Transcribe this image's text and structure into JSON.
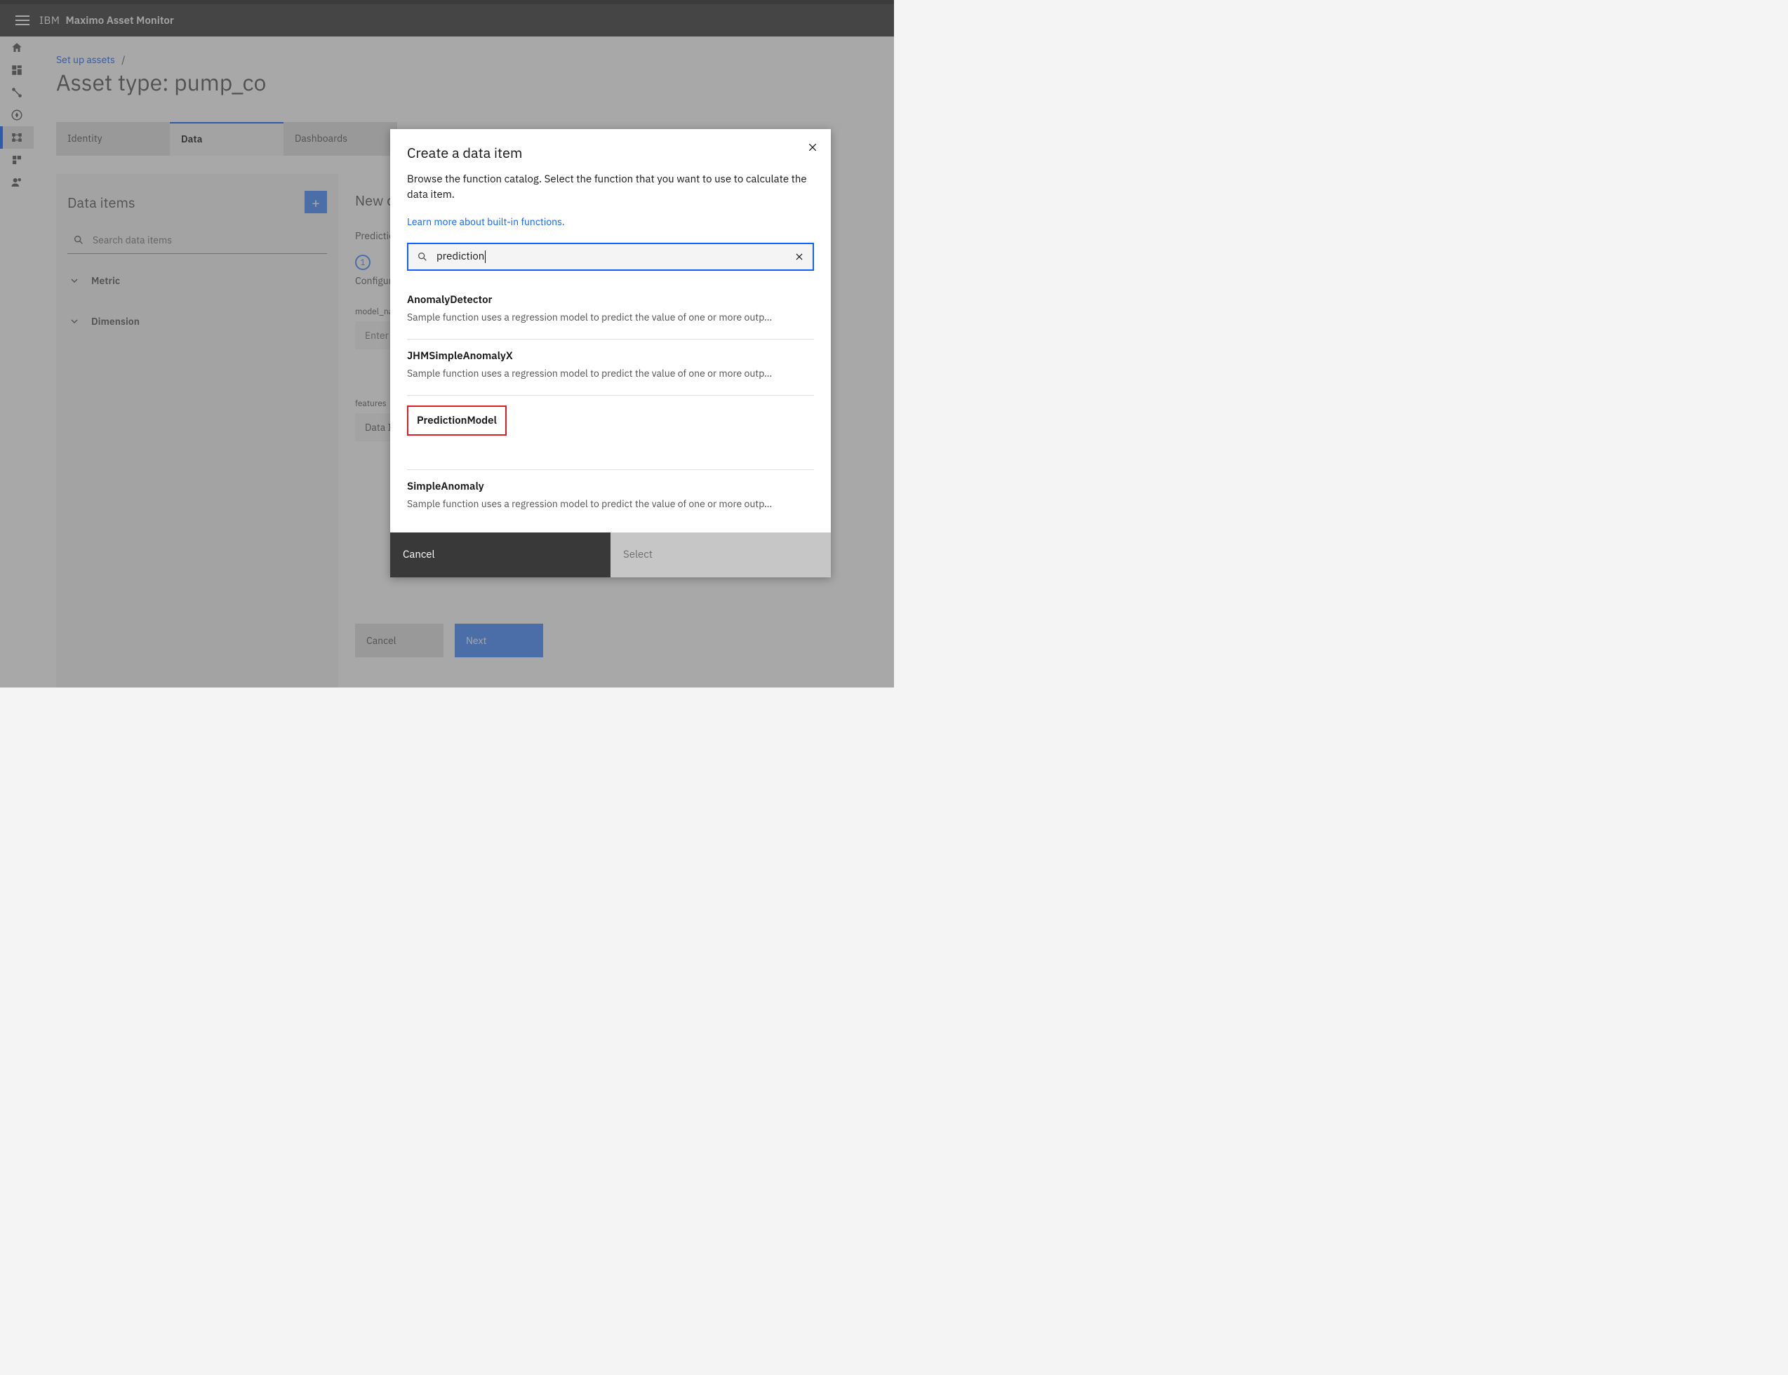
{
  "header": {
    "ibm": "IBM",
    "product": "Maximo Asset Monitor"
  },
  "sidebar": {},
  "breadcrumb": {
    "link": "Set up assets",
    "slash": "/"
  },
  "page": {
    "title": "Asset type: pump_co"
  },
  "tabs": {
    "items": [
      {
        "label": "Identity",
        "active": false
      },
      {
        "label": "Data",
        "active": true
      },
      {
        "label": "Dashboards",
        "active": false
      }
    ]
  },
  "left": {
    "title": "Data items",
    "add": "+",
    "search_placeholder": "Search data items",
    "accordion": [
      {
        "label": "Metric"
      },
      {
        "label": "Dimension"
      }
    ]
  },
  "right": {
    "title": "New data item",
    "subtitle": "Prediction",
    "step_num": "1",
    "step_label": "Configuration",
    "field1_label": "model_name",
    "field1_placeholder": "Enter a value",
    "field2_label": "features",
    "field2_value": "Data Item",
    "cancel": "Cancel",
    "next": "Next"
  },
  "modal": {
    "title": "Create a data item",
    "desc": "Browse the function catalog. Select the function that you want to use to calculate the data item.",
    "link": "Learn more about built-in functions.",
    "search_value": "prediction",
    "results": [
      {
        "title": "AnomalyDetector",
        "desc": "Sample function uses a regression model to predict the value of one or more outp…",
        "highlight": false
      },
      {
        "title": "JHMSimpleAnomalyX",
        "desc": "Sample function uses a regression model to predict the value of one or more outp…",
        "highlight": false
      },
      {
        "title": "PredictionModel",
        "desc": "",
        "highlight": true
      },
      {
        "title": "SimpleAnomaly",
        "desc": "Sample function uses a regression model to predict the value of one or more outp…",
        "highlight": false
      }
    ],
    "cancel": "Cancel",
    "select": "Select"
  }
}
